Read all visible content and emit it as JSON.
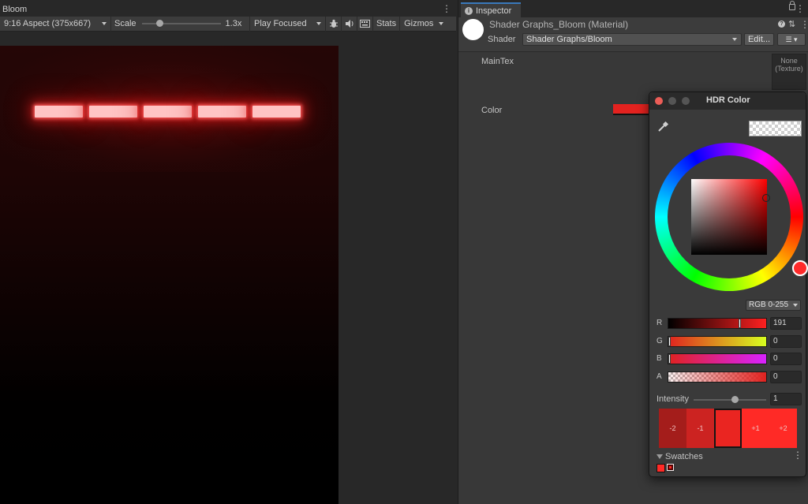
{
  "game": {
    "tab_title": "Bloom",
    "aspect": "9:16 Aspect (375x667)",
    "scale_label": "Scale",
    "scale_value": "1.3x",
    "scale_fraction": 0.2,
    "play_mode": "Play Focused",
    "stats_label": "Stats",
    "gizmos_label": "Gizmos",
    "brick_color": "#ffc4c4",
    "brick_count": 5
  },
  "inspector": {
    "tab_title": "Inspector",
    "material_title": "Shader Graphs_Bloom (Material)",
    "shader_label": "Shader",
    "shader_value": "Shader Graphs/Bloom",
    "edit_label": "Edit...",
    "list_label": "☰ ▾",
    "maintex_label": "MainTex",
    "texture_slot": "None\n(Texture)",
    "color_label": "Color",
    "color_value": "#e3221f"
  },
  "hdr_color": {
    "title": "HDR Color",
    "mode": "RGB 0-255",
    "channels": [
      {
        "label": "R",
        "value": "191",
        "fraction": 0.749
      },
      {
        "label": "G",
        "value": "0",
        "fraction": 0.0
      },
      {
        "label": "B",
        "value": "0",
        "fraction": 0.0
      },
      {
        "label": "A",
        "value": "0",
        "fraction": 0.0
      }
    ],
    "intensity_label": "Intensity",
    "intensity_value": "1",
    "exposure_steps": [
      "-2",
      "-1",
      "",
      "+1",
      "+2"
    ],
    "swatches_label": "Swatches",
    "accent_color": "#ff2a26"
  }
}
